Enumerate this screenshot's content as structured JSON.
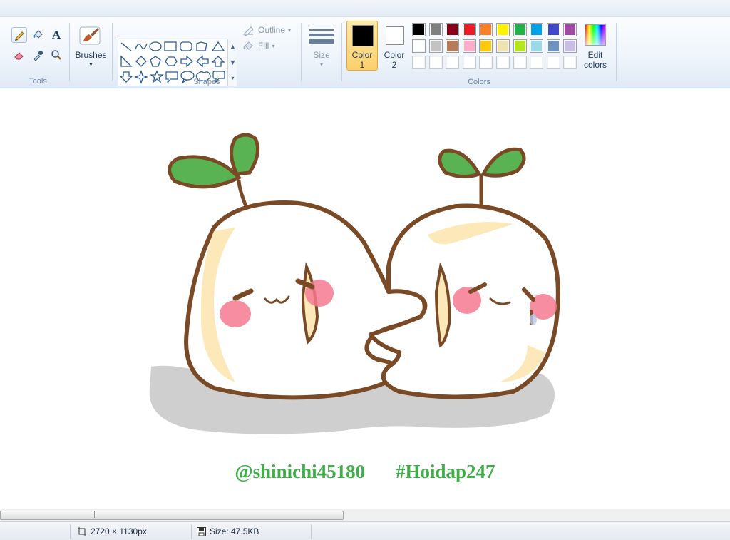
{
  "ribbon": {
    "groups": {
      "tools": "Tools",
      "shapes": "Shapes",
      "colors": "Colors"
    },
    "brushes_label": "Brushes",
    "outline_label": "Outline",
    "fill_label": "Fill",
    "size_label": "Size",
    "color1_label_line1": "Color",
    "color1_label_line2": "1",
    "color2_label_line1": "Color",
    "color2_label_line2": "2",
    "edit_colors_line1": "Edit",
    "edit_colors_line2": "colors",
    "color1_value": "#000000",
    "color2_value": "#ffffff",
    "palette_row1": [
      "#000000",
      "#7f7f7f",
      "#880015",
      "#ed1c24",
      "#ff7f27",
      "#fff200",
      "#22b14c",
      "#00a2e8",
      "#3f48cc",
      "#a349a4"
    ],
    "palette_row2": [
      "#ffffff",
      "#c3c3c3",
      "#b97a57",
      "#ffaec9",
      "#ffc90e",
      "#efe4b0",
      "#b5e61d",
      "#99d9ea",
      "#7092be",
      "#c8bfe7"
    ],
    "palette_row3": [
      "#ffffff",
      "#ffffff",
      "#ffffff",
      "#ffffff",
      "#ffffff",
      "#ffffff",
      "#ffffff",
      "#ffffff",
      "#ffffff",
      "#ffffff"
    ],
    "tool_icons": [
      "pencil-icon",
      "fill-bucket-icon",
      "text-icon",
      "eraser-icon",
      "color-picker-icon",
      "magnifier-icon"
    ]
  },
  "canvas": {
    "credit_left": "@shinichi45180",
    "credit_right": "#Hoidap247",
    "credit_color": "#3fae49"
  },
  "status": {
    "dimensions": "2720 × 1130px",
    "size": "Size: 47.5KB"
  }
}
